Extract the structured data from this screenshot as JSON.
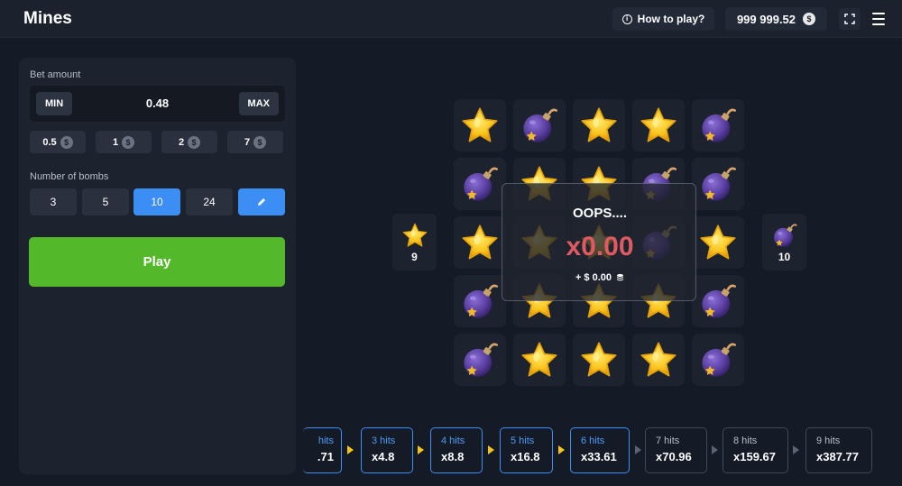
{
  "header": {
    "title": "Mines",
    "how_to_play": "How to play?",
    "balance": "999 999.52",
    "currency_icon": "$"
  },
  "panel": {
    "bet_label": "Bet amount",
    "min_label": "MIN",
    "max_label": "MAX",
    "bet_value": "0.48",
    "quick_amounts": [
      "0.5",
      "1",
      "2",
      "7"
    ],
    "bombs_label": "Number of bombs",
    "bomb_options": [
      "3",
      "5",
      "10",
      "24"
    ],
    "selected_bombs": "10",
    "play_label": "Play"
  },
  "board": {
    "grid": [
      [
        "star",
        "bomb",
        "star",
        "star",
        "bomb"
      ],
      [
        "bomb",
        "star",
        "star",
        "bomb",
        "bomb"
      ],
      [
        "star",
        "star",
        "star",
        "bomb",
        "star"
      ],
      [
        "bomb",
        "star",
        "star",
        "star",
        "bomb"
      ],
      [
        "bomb",
        "star",
        "star",
        "star",
        "bomb"
      ]
    ],
    "stars_count": "9",
    "bombs_count": "10"
  },
  "result": {
    "title": "OOPS....",
    "multiplier": "x0.00",
    "win": "+ $ 0.00"
  },
  "hits": [
    {
      "label": "hits",
      "mult": ".71",
      "state": "done"
    },
    {
      "label": "3 hits",
      "mult": "x4.8",
      "state": "done"
    },
    {
      "label": "4 hits",
      "mult": "x8.8",
      "state": "done"
    },
    {
      "label": "5 hits",
      "mult": "x16.8",
      "state": "done"
    },
    {
      "label": "6 hits",
      "mult": "x33.61",
      "state": "done"
    },
    {
      "label": "7 hits",
      "mult": "x70.96",
      "state": "pending"
    },
    {
      "label": "8 hits",
      "mult": "x159.67",
      "state": "pending"
    },
    {
      "label": "9 hits",
      "mult": "x387.77",
      "state": "pending"
    }
  ],
  "colors": {
    "accent": "#3d8ef4",
    "play": "#54b92a",
    "loss": "#e05a61",
    "star": "#f7c520",
    "bomb": "#5a3fa0"
  }
}
